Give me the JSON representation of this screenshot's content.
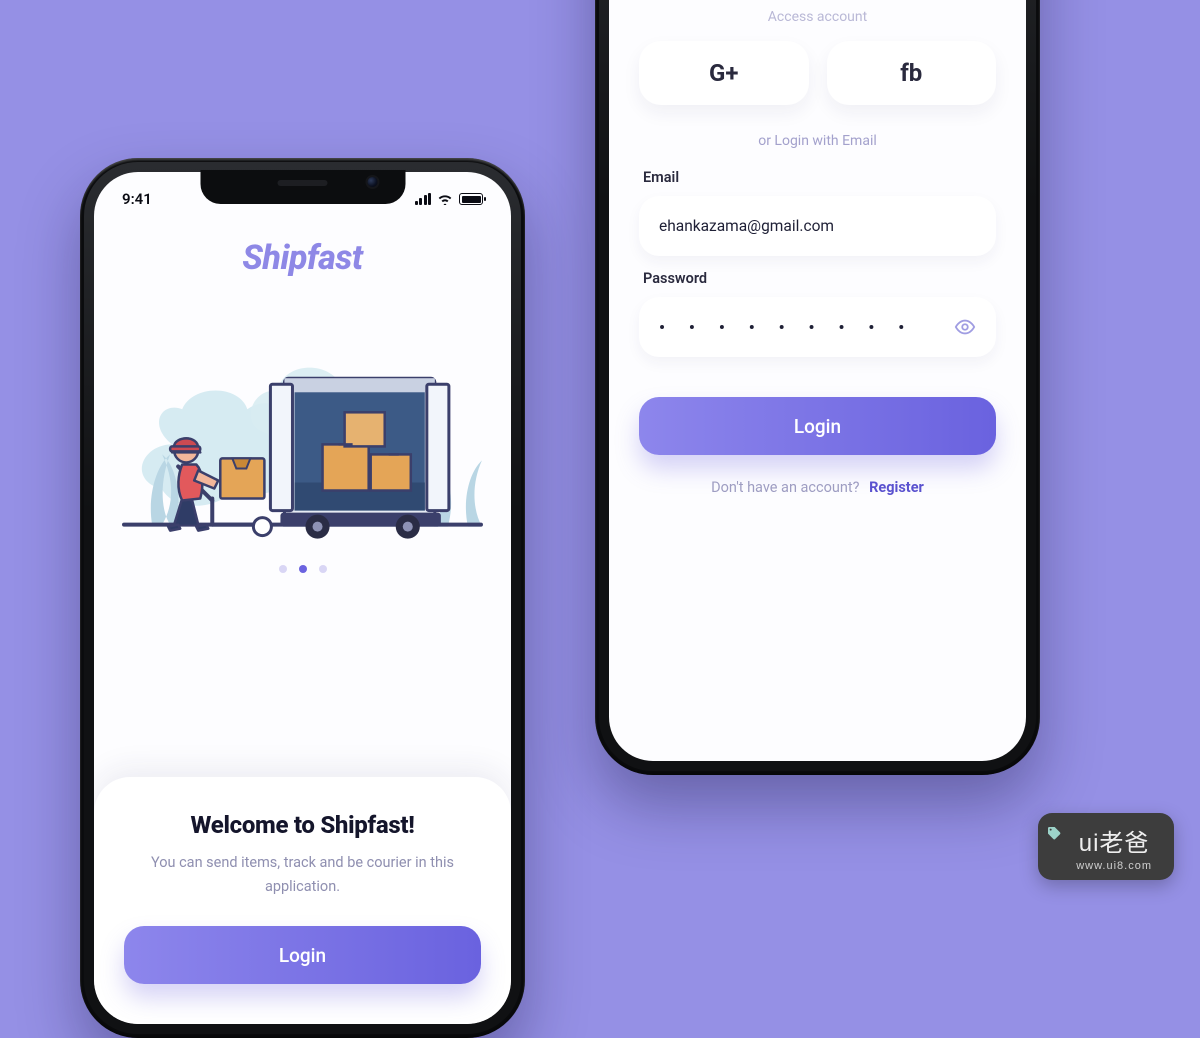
{
  "colors": {
    "backdrop": "#9590E5",
    "accent_start": "#8d86ec",
    "accent_end": "#6a62df",
    "text_dark": "#14152b",
    "text_muted": "#8f8fb0"
  },
  "status": {
    "time": "9:41"
  },
  "onboarding": {
    "brand": "Shipfast",
    "page_index": 1,
    "page_count": 3,
    "title": "Welcome to Shipfast!",
    "subtitle": "You can send items, track and be courier in this application.",
    "login_label": "Login"
  },
  "login": {
    "header_hint": "Access account",
    "social": {
      "google": "G+",
      "facebook": "fb"
    },
    "or_text": "or Login with Email",
    "email_label": "Email",
    "email_value": "ehankazama@gmail.com",
    "password_label": "Password",
    "password_mask": "• • • • • • • • •",
    "submit_label": "Login",
    "no_account_text": "Don't have an account?",
    "register_label": "Register"
  },
  "watermark": {
    "name": "ui老爸",
    "url": "www.ui8.com"
  }
}
